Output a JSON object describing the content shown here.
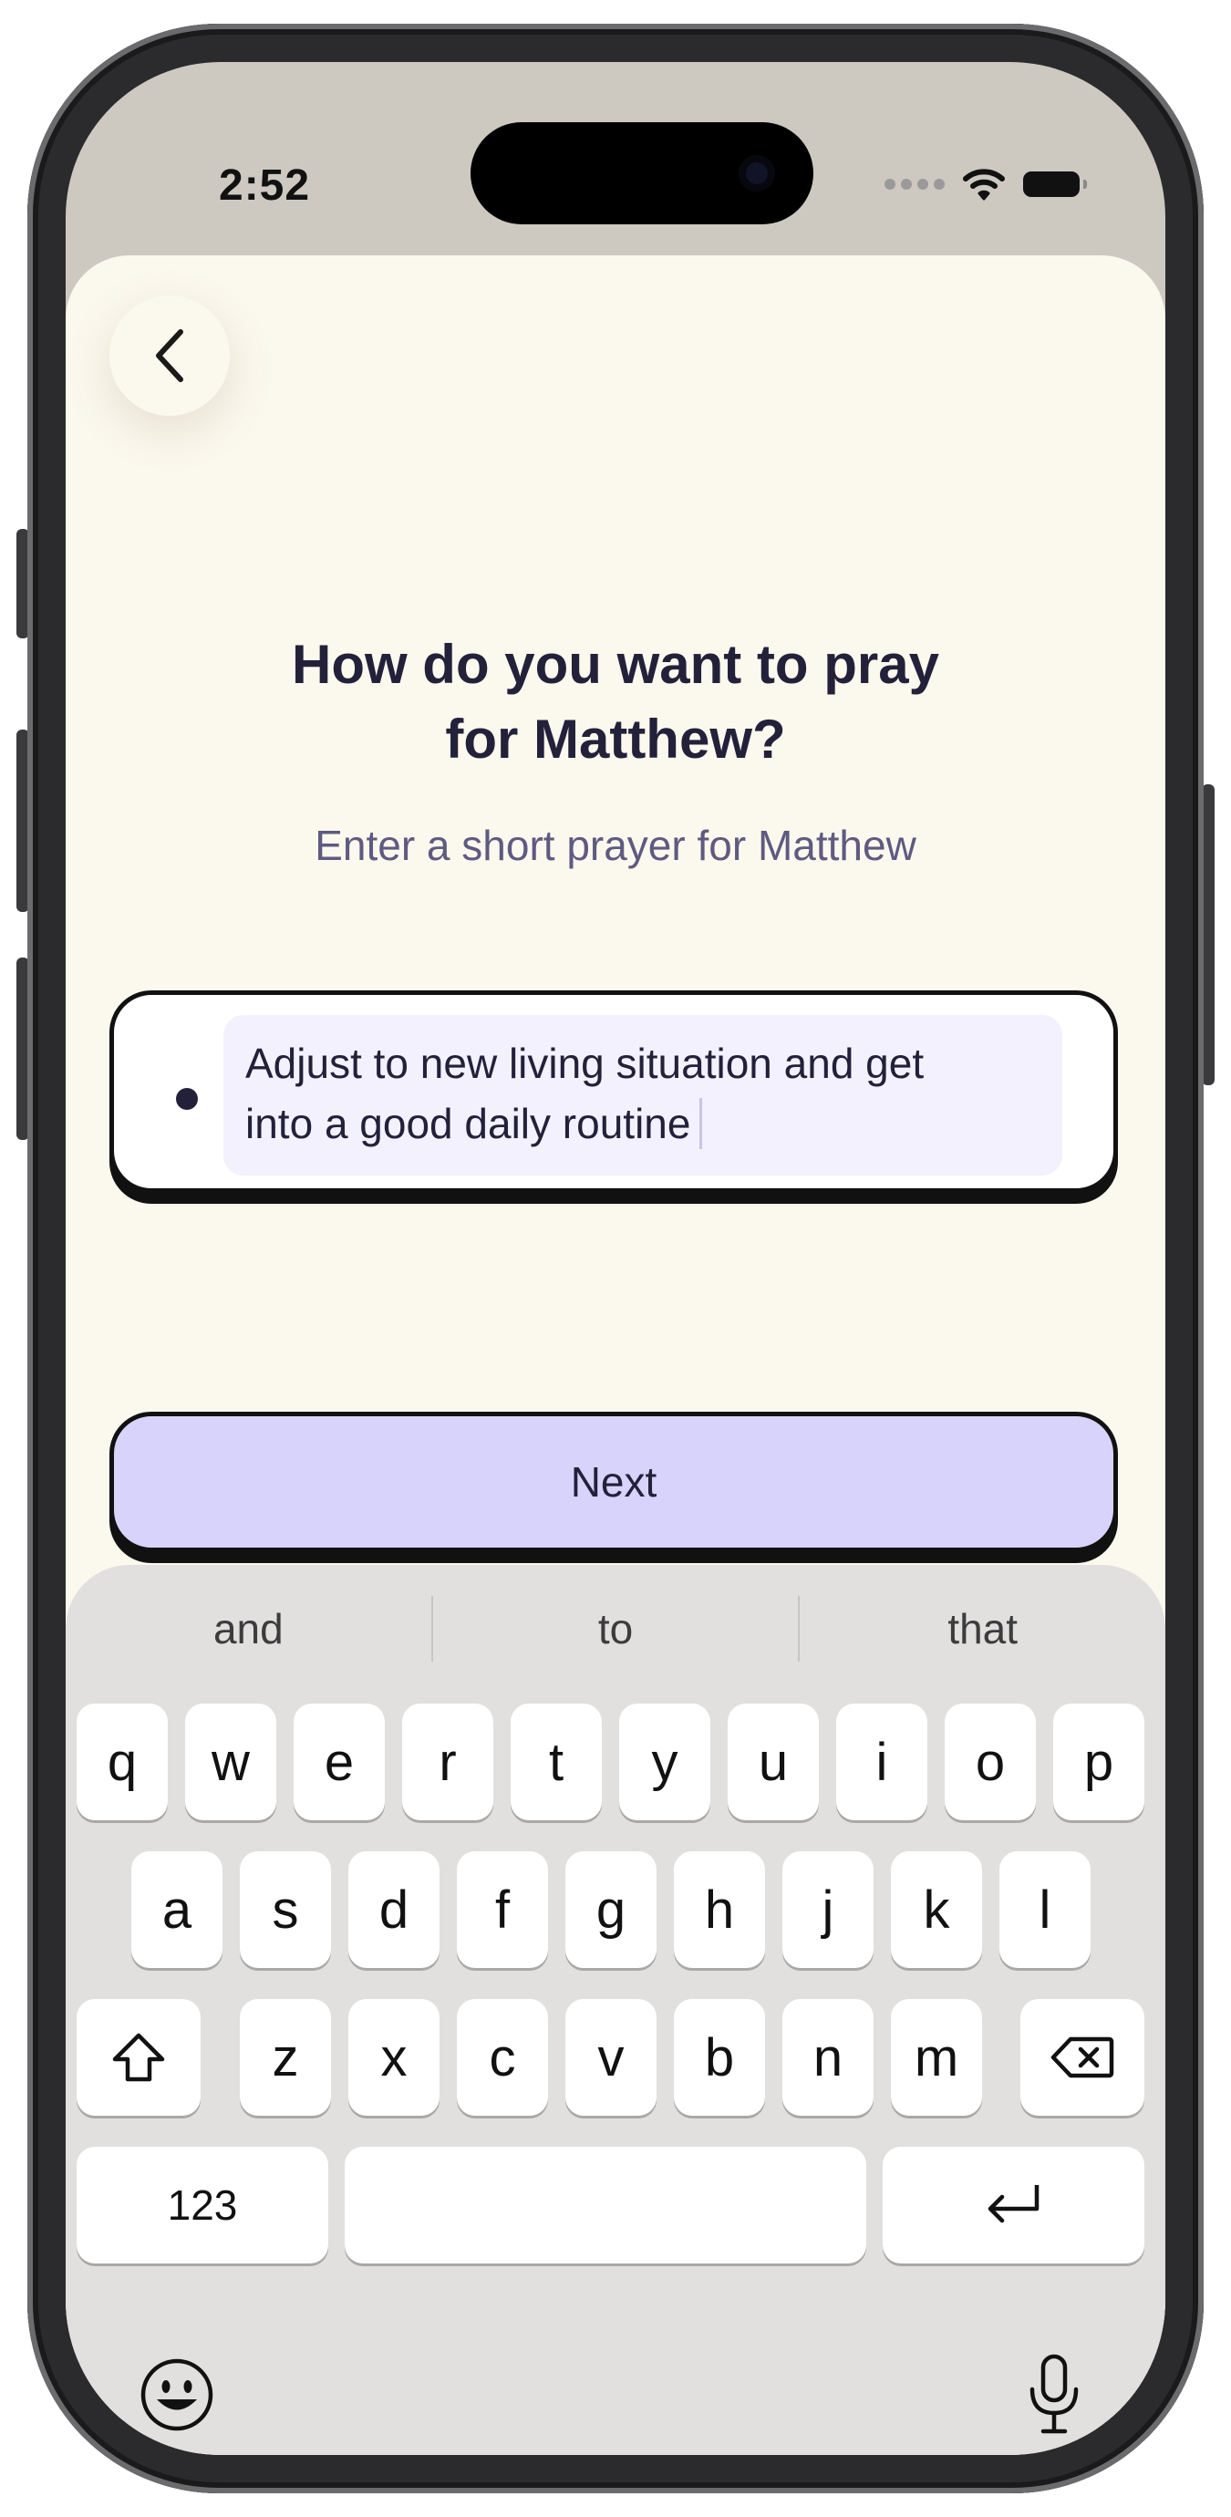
{
  "status_bar": {
    "time": "2:52",
    "icons": [
      "cellular-icon",
      "wifi-icon",
      "battery-icon"
    ]
  },
  "screen": {
    "back_icon": "chevron-left-icon",
    "title_line1": "How do you want to pray",
    "title_line2": "for Matthew?",
    "subtitle": "Enter a short prayer for Matthew",
    "prayer_input": {
      "line1": "Adjust to new living situation and get",
      "line2": "into a good daily routine"
    },
    "next_label": "Next"
  },
  "keyboard": {
    "suggestions": [
      "and",
      "to",
      "that"
    ],
    "row1": [
      "q",
      "w",
      "e",
      "r",
      "t",
      "y",
      "u",
      "i",
      "o",
      "p"
    ],
    "row2": [
      "a",
      "s",
      "d",
      "f",
      "g",
      "h",
      "j",
      "k",
      "l"
    ],
    "row3": [
      "z",
      "x",
      "c",
      "v",
      "b",
      "n",
      "m"
    ],
    "numbers_label": "123",
    "icons": [
      "shift-icon",
      "backspace-icon",
      "return-icon",
      "emoji-icon",
      "microphone-icon"
    ]
  },
  "colors": {
    "sheet_background": "#fbf8ee",
    "primary_button": "#d8d3fa",
    "text_primary": "#23213a",
    "text_secondary": "#5f5a80",
    "keyboard_background": "#e1e0de"
  }
}
